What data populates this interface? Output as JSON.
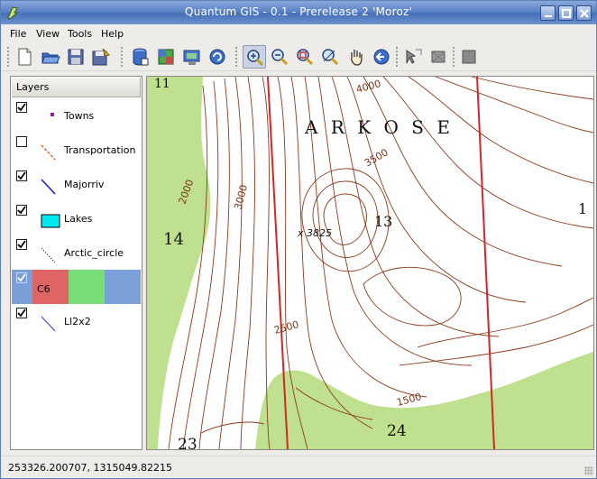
{
  "window": {
    "title": "Quantum GIS - 0.1 - Prerelease 2 'Moroz'"
  },
  "menu": {
    "items": [
      {
        "label": "File"
      },
      {
        "label": "View"
      },
      {
        "label": "Tools"
      },
      {
        "label": "Help"
      }
    ]
  },
  "toolbar": {
    "buttons": [
      {
        "icon": "new-document-icon"
      },
      {
        "icon": "open-folder-icon"
      },
      {
        "icon": "save-icon"
      },
      {
        "icon": "save-as-icon"
      },
      {
        "icon": "add-vector-layer-icon"
      },
      {
        "icon": "add-raster-layer-icon"
      },
      {
        "icon": "add-postgis-layer-icon"
      },
      {
        "icon": "refresh-icon"
      },
      {
        "icon": "zoom-in-icon",
        "active": true
      },
      {
        "icon": "zoom-out-icon"
      },
      {
        "icon": "zoom-full-icon"
      },
      {
        "icon": "zoom-selection-icon"
      },
      {
        "icon": "pan-hand-icon"
      },
      {
        "icon": "zoom-previous-icon"
      },
      {
        "icon": "identify-icon"
      },
      {
        "icon": "select-features-icon"
      },
      {
        "icon": "attribute-table-icon"
      }
    ]
  },
  "legend": {
    "header": "Layers",
    "layers": [
      {
        "name": "Towns",
        "checked": true,
        "symbol": "point",
        "color": "#8b1fa8"
      },
      {
        "name": "Transportation",
        "checked": false,
        "symbol": "dashed-line",
        "color": "#d9682a"
      },
      {
        "name": "Majorriv",
        "checked": true,
        "symbol": "line",
        "color": "#1c1cc8"
      },
      {
        "name": "Lakes",
        "checked": true,
        "symbol": "polygon",
        "color": "#00e8f0"
      },
      {
        "name": "Arctic_circle",
        "checked": true,
        "symbol": "dotted-line",
        "color": "#333333"
      },
      {
        "name": "C6",
        "checked": true,
        "symbol": "raster",
        "selected": true
      },
      {
        "name": "Ll2x2",
        "checked": true,
        "symbol": "line",
        "color": "#3a3ad0"
      }
    ]
  },
  "map": {
    "labels": {
      "region": "A R K O S E",
      "c4000": "4000",
      "c3500": "3500",
      "c3000": "3000",
      "c2000": "2000",
      "c2500": "2500",
      "c1500": "1500",
      "peak": "x 3825",
      "sec13": "13",
      "sec14": "14",
      "sec24": "24",
      "sec23": "23",
      "sec11": "11",
      "sec1": "1"
    },
    "colors": {
      "contour": "#8a3a1c",
      "vegetation": "#bfe08f",
      "gridline": "#d02828"
    }
  },
  "status": {
    "coordinates": "253326.200707, 1315049.82215"
  }
}
